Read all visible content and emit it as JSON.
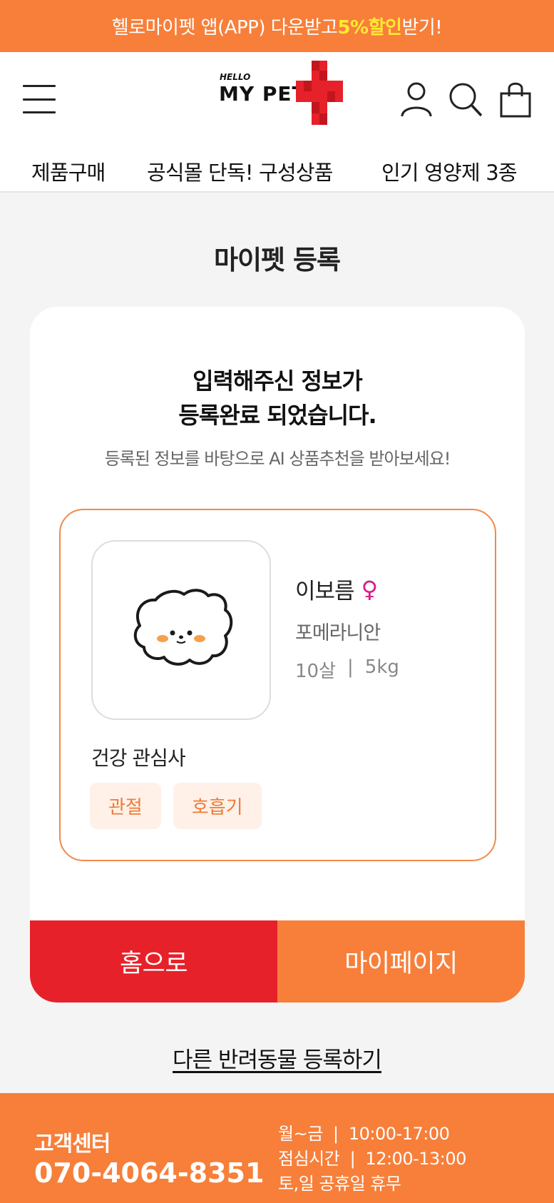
{
  "promo": {
    "text_before": "헬로마이펫 앱(APP) 다운받고",
    "highlight": "5%할인",
    "text_after": " 받기!"
  },
  "header": {
    "logo_small": "HELLO",
    "logo_main": "MY PET",
    "nav": [
      "제품구매",
      "공식몰 단독! 구성상품",
      "인기 영양제 3종"
    ]
  },
  "page_title": "마이펫 등록",
  "card": {
    "headline_line1": "입력해주신 정보가",
    "headline_line2": "등록완료 되었습니다.",
    "subline": "등록된 정보를 바탕으로 AI 상품추천을 받아보세요!",
    "pet": {
      "name": "이보름",
      "gender_symbol": "♀",
      "breed": "포메라니안",
      "age": "10살",
      "separator": "|",
      "weight": "5kg"
    },
    "interest_title": "건강 관심사",
    "interests": [
      "관절",
      "호흡기"
    ],
    "buttons": {
      "home": "홈으로",
      "mypage": "마이페이지"
    }
  },
  "register_other": "다른 반려동물 등록하기",
  "footer": {
    "cs_title": "고객센터",
    "phone": "070-4064-8351",
    "hours_weekday": "월~금  |  10:00-17:00",
    "hours_lunch": "점심시간  |  12:00-13:00",
    "hours_holiday": "토,일 공휴일 휴무"
  },
  "colors": {
    "brand_orange": "#f77f3a",
    "brand_red": "#e62129",
    "promo_highlight": "#ffe836",
    "gender_female": "#d81b8a"
  },
  "icons": [
    "hamburger-menu-icon",
    "user-icon",
    "search-icon",
    "shopping-bag-icon",
    "pet-avatar-icon"
  ]
}
